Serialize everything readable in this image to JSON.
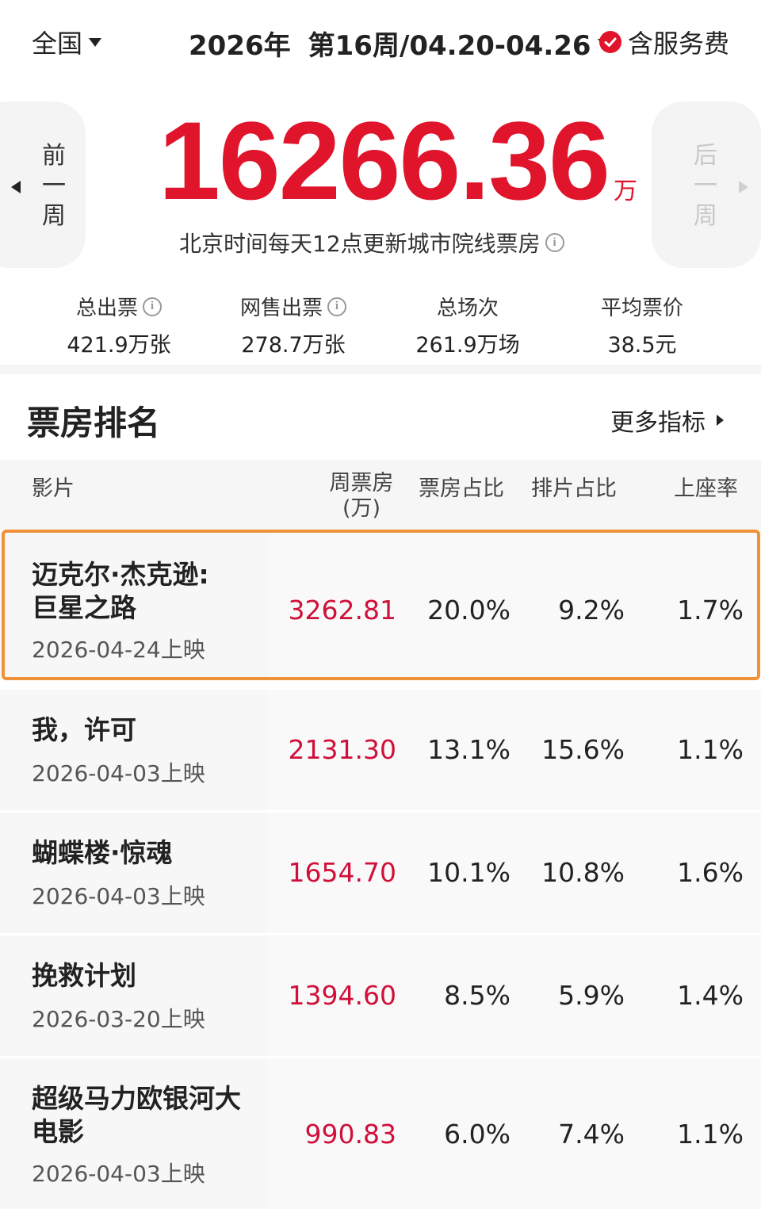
{
  "header": {
    "region": "全国",
    "year": "2026年",
    "week_range": "第16周/04.20-04.26",
    "service_fee_label": "含服务费"
  },
  "summary": {
    "prev_week_label": [
      "前",
      "一",
      "周"
    ],
    "next_week_label": [
      "后",
      "一",
      "周"
    ],
    "total_box_office": "16266.36",
    "unit": "万",
    "update_note": "北京时间每天12点更新城市院线票房"
  },
  "stats": [
    {
      "label": "总出票",
      "value": "421.9万张"
    },
    {
      "label": "网售出票",
      "value": "278.7万张"
    },
    {
      "label": "总场次",
      "value": "261.9万场"
    },
    {
      "label": "平均票价",
      "value": "38.5元"
    }
  ],
  "ranking": {
    "title": "票房排名",
    "more_label": "更多指标",
    "columns": {
      "film": "影片",
      "weekly_box": "周票房",
      "weekly_box_unit": "(万)",
      "box_share": "票房占比",
      "schedule_share": "排片占比",
      "seat_rate": "上座率"
    },
    "rows": [
      {
        "name_line1": "迈克尔·杰克逊:",
        "name_line2": "巨星之路",
        "release": "2026-04-24上映",
        "box": "3262.81",
        "share": "20.0%",
        "sched": "9.2%",
        "seat": "1.7%"
      },
      {
        "name_line1": "我，许可",
        "name_line2": "",
        "release": "2026-04-03上映",
        "box": "2131.30",
        "share": "13.1%",
        "sched": "15.6%",
        "seat": "1.1%"
      },
      {
        "name_line1": "蝴蝶楼·惊魂",
        "name_line2": "",
        "release": "2026-04-03上映",
        "box": "1654.70",
        "share": "10.1%",
        "sched": "10.8%",
        "seat": "1.6%"
      },
      {
        "name_line1": "挽救计划",
        "name_line2": "",
        "release": "2026-03-20上映",
        "box": "1394.60",
        "share": "8.5%",
        "sched": "5.9%",
        "seat": "1.4%"
      },
      {
        "name_line1": "超级马力欧银河大",
        "name_line2": "电影",
        "release": "2026-04-03上映",
        "box": "990.83",
        "share": "6.0%",
        "sched": "7.4%",
        "seat": "1.1%"
      }
    ]
  },
  "colors": {
    "accent_red": "#e0142b",
    "highlight_orange": "#f0923a"
  }
}
